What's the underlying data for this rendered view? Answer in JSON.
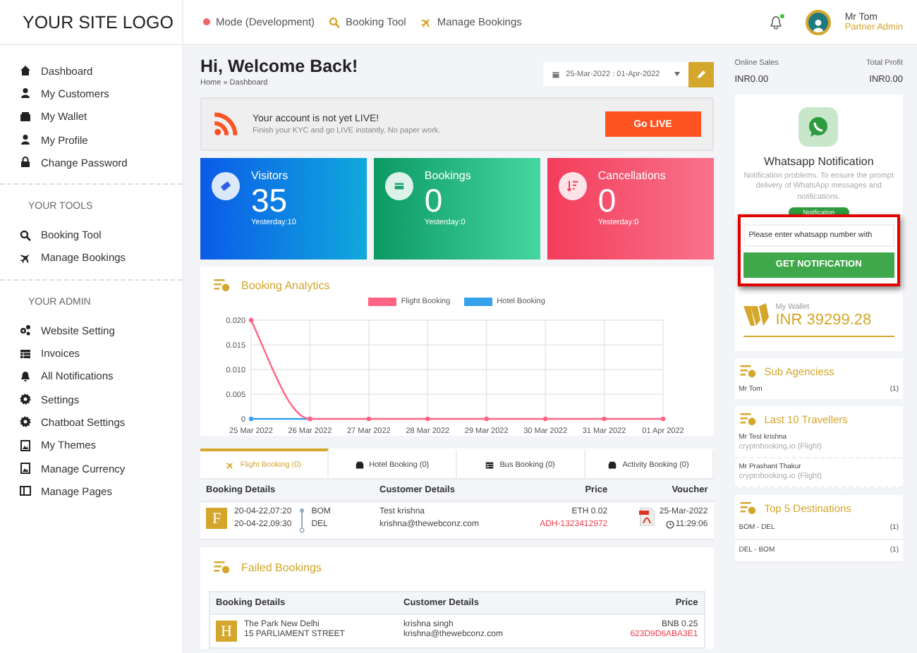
{
  "logo": "YOUR SITE LOGO",
  "sidebar": {
    "main_items": [
      "Dashboard",
      "My Customers",
      "My Wallet",
      "My Profile",
      "Change Password"
    ],
    "sections": [
      {
        "heading": "YOUR TOOLS",
        "items": [
          "Booking Tool",
          "Manage Bookings"
        ]
      },
      {
        "heading": "YOUR ADMIN",
        "items": [
          "Website Setting",
          "Invoices",
          "All Notifications",
          "Settings",
          "Chatboat Settings",
          "My Themes",
          "Manage Currency",
          "Manage Pages"
        ]
      }
    ]
  },
  "header": {
    "mode": "Mode (Development)",
    "links": [
      "Booking Tool",
      "Manage Bookings"
    ],
    "user": {
      "name": "Mr Tom",
      "role": "Partner Admin"
    }
  },
  "page": {
    "title": "Hi, Welcome Back!",
    "breadcrumb": "Home » Dashboard",
    "date_range": "25-Mar-2022 : 01-Apr-2022"
  },
  "alert": {
    "title": "Your account is not yet LIVE!",
    "message": "Finish your KYC and go LIVE instantly. No paper work.",
    "button": "Go LIVE"
  },
  "stats": [
    {
      "label": "Visitors",
      "value": "35",
      "yesterday": "Yesterday:10"
    },
    {
      "label": "Bookings",
      "value": "0",
      "yesterday": "Yesterday:0"
    },
    {
      "label": "Cancellations",
      "value": "0",
      "yesterday": "Yesterday:0"
    }
  ],
  "analytics": {
    "title": "Booking Analytics",
    "chart_data": {
      "type": "line",
      "categories": [
        "25 Mar 2022",
        "26 Mar 2022",
        "27 Mar 2022",
        "28 Mar 2022",
        "29 Mar 2022",
        "30 Mar 2022",
        "31 Mar 2022",
        "01 Apr 2022"
      ],
      "series": [
        {
          "name": "Flight Booking",
          "color": "#ff6384",
          "marker": true,
          "values": [
            0.02,
            0,
            0,
            0,
            0,
            0,
            0,
            0
          ]
        },
        {
          "name": "Hotel Booking",
          "color": "#36a2eb",
          "marker": true,
          "values": [
            0,
            0,
            null,
            null,
            null,
            null,
            null,
            null
          ]
        }
      ],
      "ylim": [
        0,
        0.02
      ],
      "grid": true,
      "yticks": [
        {
          "value": 0,
          "label": "0"
        },
        {
          "value": 0.005,
          "label": "0.005"
        },
        {
          "value": 0.01,
          "label": "0.010"
        },
        {
          "value": 0.015,
          "label": "0.015"
        },
        {
          "value": 0.02,
          "label": "0.020"
        }
      ]
    }
  },
  "booking_tabs": [
    {
      "label": "Flight Booking (0)",
      "selected": true
    },
    {
      "label": "Hotel Booking (0)",
      "selected": false
    },
    {
      "label": "Bus Booking (0)",
      "selected": false
    },
    {
      "label": "Activity Booking (0)",
      "selected": false
    }
  ],
  "bookings_table": {
    "columns": [
      "Booking Details",
      "Customer Details",
      "Price",
      "Voucher"
    ],
    "rows": [
      {
        "badge": "F",
        "depart": "20-04-22,07:20",
        "arrive": "20-04-22,09:30",
        "from": "BOM",
        "to": "DEL",
        "customer": "Test krishna",
        "email": "krishna@thewebconz.com",
        "price": "ETH 0.02",
        "reference": "ADH-1323412972",
        "voucher_date": "25-Mar-2022",
        "voucher_time": "11:29:06"
      }
    ]
  },
  "failed_bookings": {
    "title": "Failed Bookings",
    "columns": [
      "Booking Details",
      "Customer Details",
      "Price"
    ],
    "rows": [
      {
        "badge": "H",
        "hotel": "The Park New Delhi",
        "address": "15 PARLIAMENT STREET",
        "customer": "krishna singh",
        "email": "krishna@thewebconz.com",
        "price": "BNB 0.25",
        "reference": "623D9D6ABA3E1"
      }
    ]
  },
  "summary": [
    {
      "label": "Online Sales",
      "value": "INR0.00"
    },
    {
      "label": "Total Profit",
      "value": "INR0.00"
    }
  ],
  "whatsapp": {
    "title": "Whatsapp Notification",
    "description": "Notification problems. To ensure the prompt delivery of WhatsApp messages and notifications.",
    "pill": "Notification",
    "placeholder": "Please enter whatsapp number with",
    "button": "GET NOTIFICATION"
  },
  "wallet": {
    "label": "My Wallet",
    "amount": "INR 39299.28"
  },
  "sub_agencies": {
    "title": "Sub Agenciess",
    "items": [
      {
        "name": "Mr Tom",
        "count": "(1)"
      }
    ]
  },
  "travellers": {
    "title": "Last 10 Travellers",
    "items": [
      {
        "name": "Mr Test krishna",
        "source": "cryptobooking.io (Flight)"
      },
      {
        "name": "Mr Prashant Thakur",
        "source": "cryptobooking.io (Flight)"
      }
    ]
  },
  "destinations": {
    "title": "Top 5 Destinations",
    "items": [
      {
        "route": "BOM - DEL",
        "count": "(1)"
      },
      {
        "route": "DEL - BOM",
        "count": "(1)"
      }
    ]
  }
}
